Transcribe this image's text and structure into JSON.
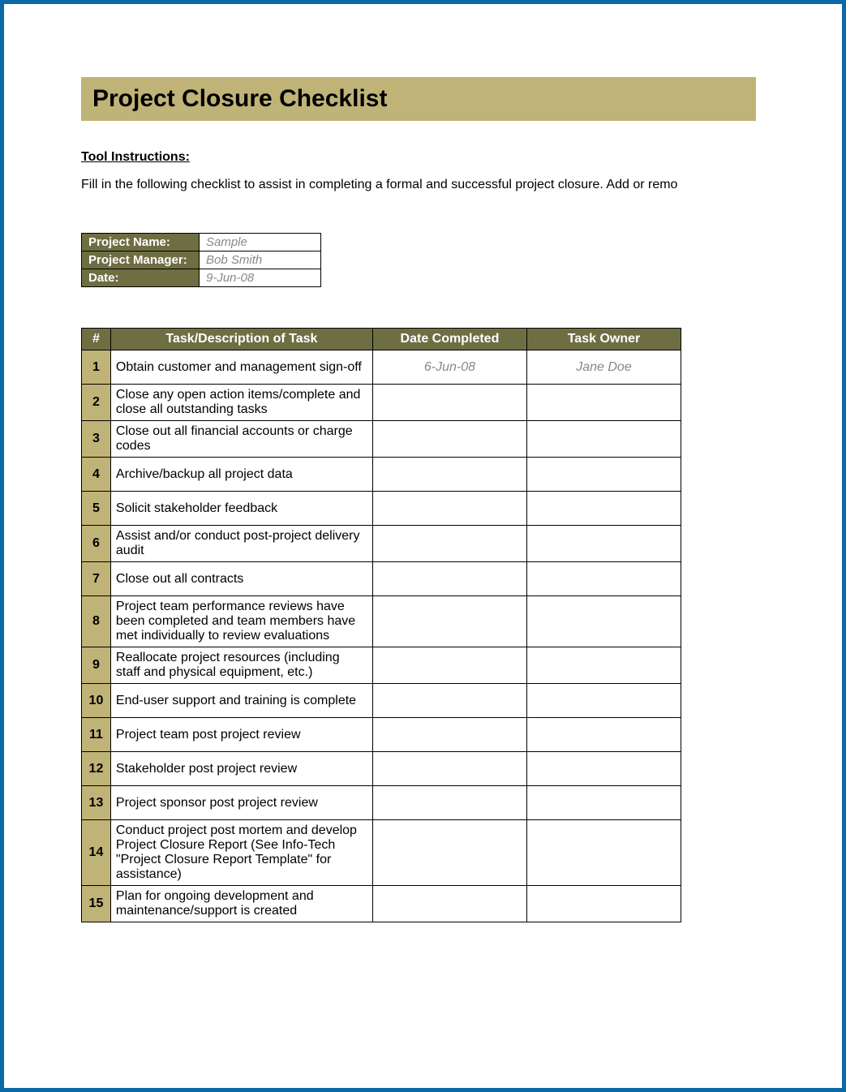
{
  "header": {
    "title": "Project Closure Checklist"
  },
  "instructions": {
    "label": "Tool Instructions:",
    "text": "Fill in the following checklist to assist in completing a formal and successful project closure. Add or remo"
  },
  "meta": {
    "rows": [
      {
        "label": "Project Name:",
        "value": "Sample"
      },
      {
        "label": "Project Manager:",
        "value": "Bob Smith"
      },
      {
        "label": "Date:",
        "value": "9-Jun-08"
      }
    ]
  },
  "checklist": {
    "headers": {
      "num": "#",
      "task": "Task/Description of Task",
      "date": "Date Completed",
      "owner": "Task Owner"
    },
    "rows": [
      {
        "num": "1",
        "task": "Obtain customer and management sign-off",
        "date": "6-Jun-08",
        "owner": "Jane Doe"
      },
      {
        "num": "2",
        "task": "Close any open action items/complete and close all outstanding tasks",
        "date": "",
        "owner": ""
      },
      {
        "num": "3",
        "task": "Close out all financial accounts or charge codes",
        "date": "",
        "owner": ""
      },
      {
        "num": "4",
        "task": "Archive/backup all project data",
        "date": "",
        "owner": ""
      },
      {
        "num": "5",
        "task": "Solicit stakeholder feedback",
        "date": "",
        "owner": ""
      },
      {
        "num": "6",
        "task": "Assist and/or conduct post-project delivery audit",
        "date": "",
        "owner": ""
      },
      {
        "num": "7",
        "task": "Close out all contracts",
        "date": "",
        "owner": ""
      },
      {
        "num": "8",
        "task": "Project team performance reviews have been completed and team members have met individually to review evaluations",
        "date": "",
        "owner": ""
      },
      {
        "num": "9",
        "task": "Reallocate project resources (including staff and physical equipment, etc.)",
        "date": "",
        "owner": ""
      },
      {
        "num": "10",
        "task": "End-user support and training is complete",
        "date": "",
        "owner": ""
      },
      {
        "num": "11",
        "task": "Project team post project review",
        "date": "",
        "owner": ""
      },
      {
        "num": "12",
        "task": "Stakeholder post project review",
        "date": "",
        "owner": ""
      },
      {
        "num": "13",
        "task": "Project sponsor post project review",
        "date": "",
        "owner": ""
      },
      {
        "num": "14",
        "task": "Conduct project post mortem and develop Project Closure Report (See Info-Tech \"Project Closure Report Template\" for assistance)",
        "date": "",
        "owner": ""
      },
      {
        "num": "15",
        "task": "Plan for ongoing development and maintenance/support is created",
        "date": "",
        "owner": ""
      }
    ]
  }
}
